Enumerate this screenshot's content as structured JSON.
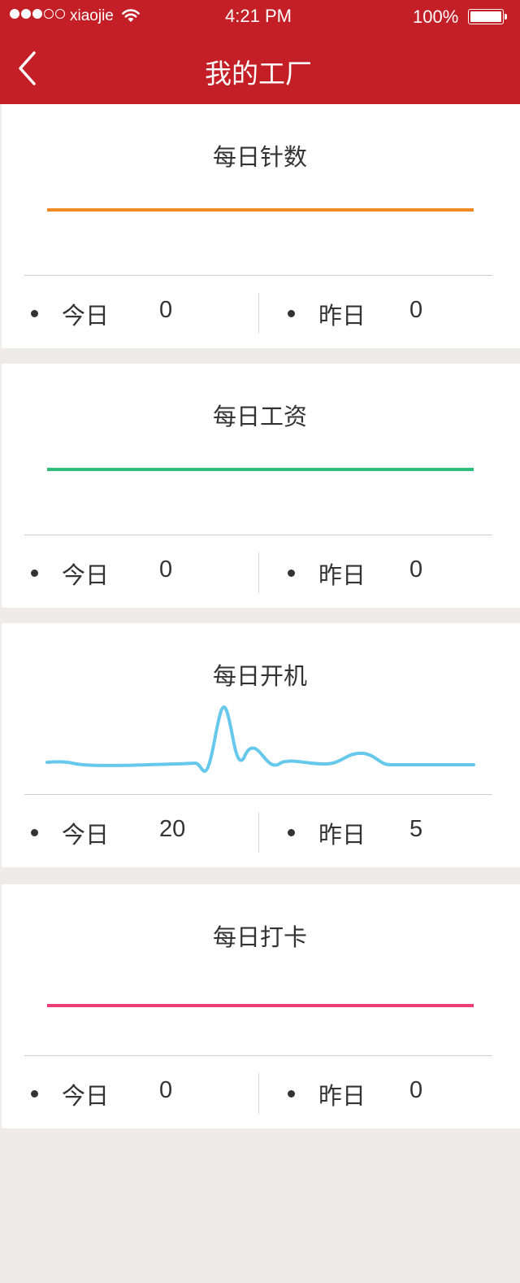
{
  "status_bar": {
    "carrier": "xiaojie",
    "time": "4:21 PM",
    "battery": "100%"
  },
  "header": {
    "title": "我的工厂",
    "back_icon": "chevron-left-icon"
  },
  "cards": [
    {
      "title": "每日针数",
      "line_color": "#f28a24",
      "today_label": "今日",
      "today_value": "0",
      "yesterday_label": "昨日",
      "yesterday_value": "0"
    },
    {
      "title": "每日工资",
      "line_color": "#2ebd7b",
      "today_label": "今日",
      "today_value": "0",
      "yesterday_label": "昨日",
      "yesterday_value": "0"
    },
    {
      "title": "每日开机",
      "line_color": "#66c8ea",
      "today_label": "今日",
      "today_value": "20",
      "yesterday_label": "昨日",
      "yesterday_value": "5"
    },
    {
      "title": "每日打卡",
      "line_color": "#ee3c74",
      "today_label": "今日",
      "today_value": "0",
      "yesterday_label": "昨日",
      "yesterday_value": "0"
    }
  ],
  "colors": {
    "brand": "#c41e26",
    "background": "#efebea"
  }
}
